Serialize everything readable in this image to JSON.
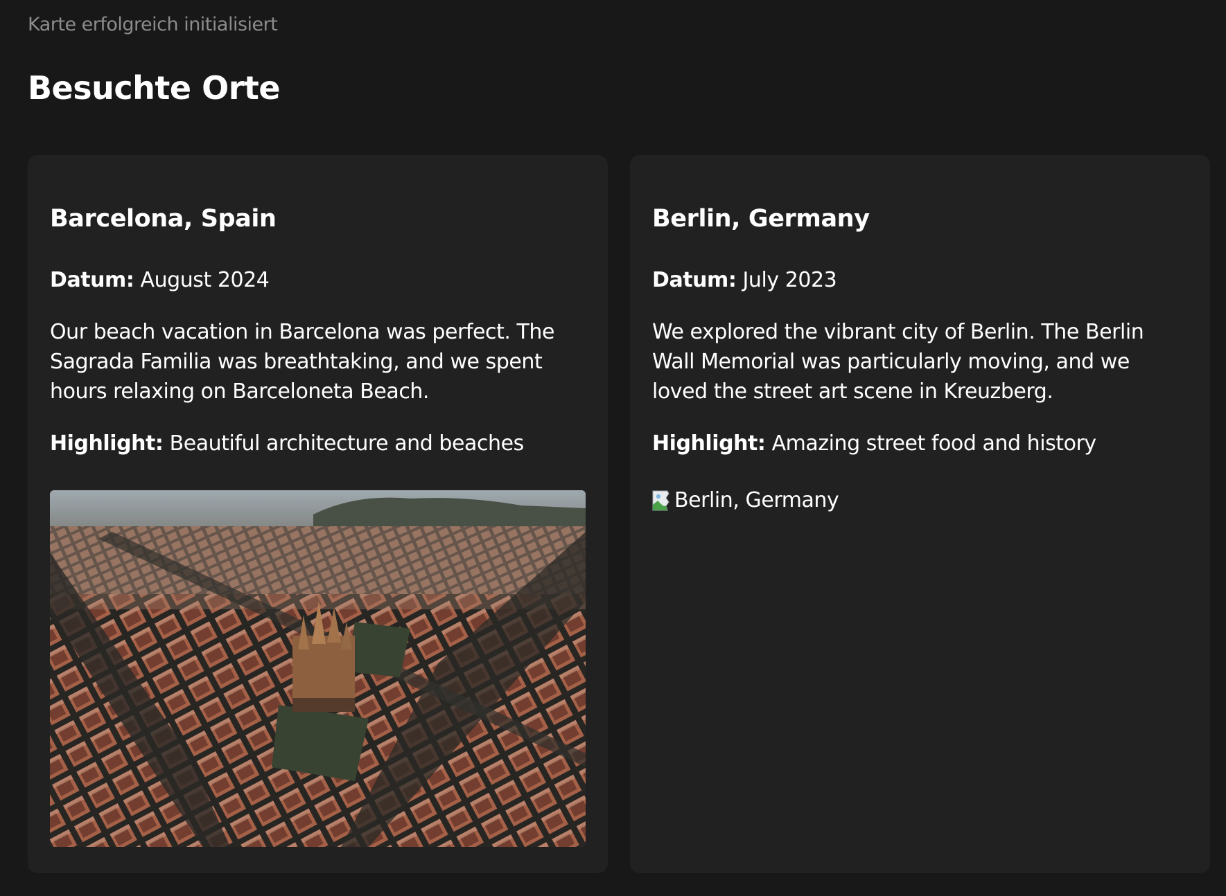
{
  "status_text": "Karte erfolgreich initialisiert",
  "page_title": "Besuchte Orte",
  "colors": {
    "background": "#181818",
    "card_background": "#212121",
    "status_text": "#8c8c8c",
    "text": "#ffffff"
  },
  "cards": [
    {
      "title": "Barcelona, Spain",
      "date_label": "Datum:",
      "date": "August 2024",
      "description": "Our beach vacation in Barcelona was perfect. The Sagrada Familia was breathtaking, and we spent hours relaxing on Barceloneta Beach.",
      "highlight_label": "Highlight:",
      "highlight": "Beautiful architecture and beaches",
      "image": {
        "alt": "Barcelona, Spain",
        "loaded": true,
        "icon": "aerial-city-photo"
      }
    },
    {
      "title": "Berlin, Germany",
      "date_label": "Datum:",
      "date": "July 2023",
      "description": "We explored the vibrant city of Berlin. The Berlin Wall Memorial was particularly moving, and we loved the street art scene in Kreuzberg.",
      "highlight_label": "Highlight:",
      "highlight": "Amazing street food and history",
      "image": {
        "alt": "Berlin, Germany",
        "loaded": false,
        "icon": "broken-image-icon"
      }
    }
  ]
}
